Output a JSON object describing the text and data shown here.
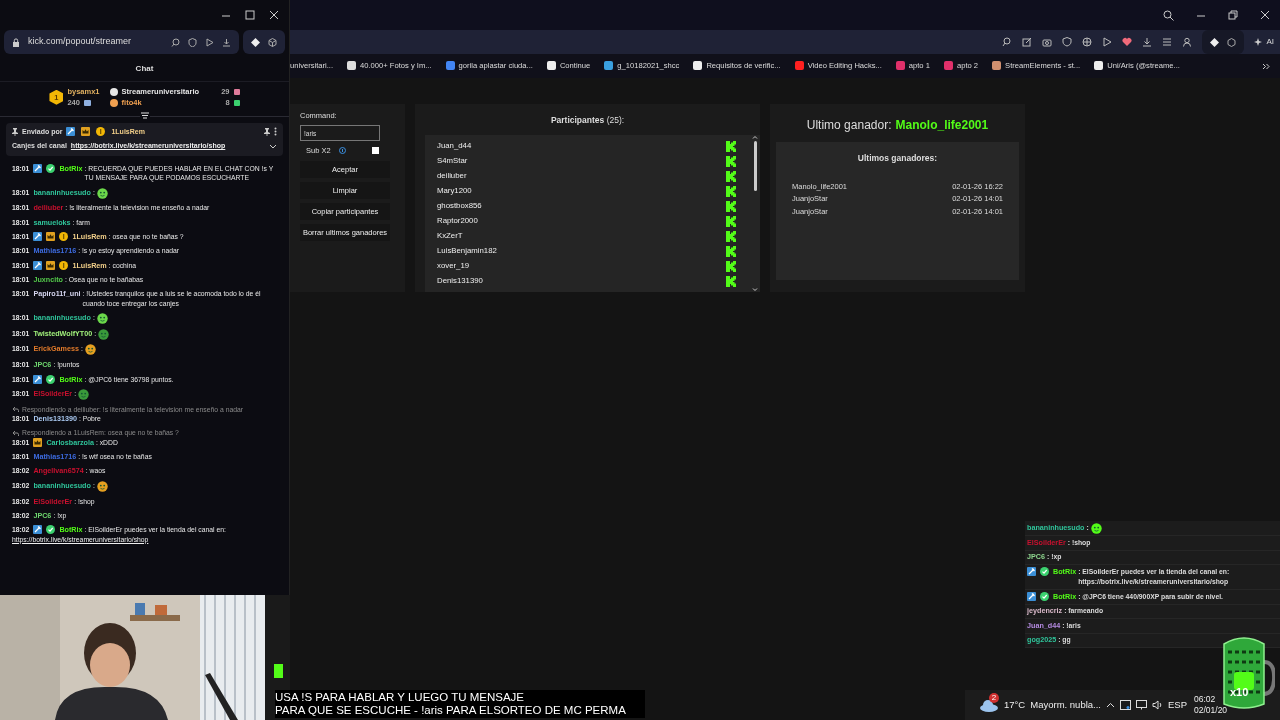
{
  "chat_window": {
    "url": "kick.com/popout/streamer",
    "header": "Chat",
    "top_viewer": {
      "rank": "1",
      "name": "bysamx1",
      "count": "240"
    },
    "leaders": [
      {
        "name": "Streameruniversitario",
        "count": "29",
        "color": "#e6e6e6"
      },
      {
        "name": "fito4k",
        "count": "8",
        "color": "#f0a050"
      }
    ],
    "pinned": {
      "label": "Enviado por",
      "sender": "1LuisRem",
      "text": "Canjes del canal",
      "link": "https://botrix.live/k/streameruniversitario/shop"
    },
    "messages": [
      {
        "time": "18:01",
        "badges": [
          {
            "kind": "hammer"
          },
          {
            "kind": "check"
          }
        ],
        "user": "BotRix",
        "color": "#53fc18",
        "kind": "text",
        "text": ": RECUERDA QUE PUEDES HABLAR EN EL CHAT CON !s Y TU MENSAJE PARA QUE PODAMOS ESCUCHARTE"
      },
      {
        "time": "18:01",
        "user": "bananinhuesudo",
        "color": "#2fc49a",
        "kind": "emote",
        "text": ":"
      },
      {
        "time": "18:01",
        "user": "deiliuber",
        "color": "#c8102e",
        "kind": "text",
        "text": ": !s literalmente la television me enseño a nadar"
      },
      {
        "time": "18:01",
        "user": "samueloks",
        "color": "#2fc49a",
        "kind": "text",
        "text": ": farm"
      },
      {
        "time": "18:01",
        "badges": [
          {
            "kind": "hammer"
          },
          {
            "kind": "crown"
          },
          {
            "kind": "coin"
          }
        ],
        "user": "1LuisRem",
        "color": "#f3d08a",
        "kind": "text",
        "text": ": osea que no te bañas ?"
      },
      {
        "time": "18:01",
        "user": "Mathias1716",
        "color": "#3d6be0",
        "kind": "text",
        "text": ": !s yo estoy aprendiendo a nadar"
      },
      {
        "time": "18:01",
        "badges": [
          {
            "kind": "hammer"
          },
          {
            "kind": "crown"
          },
          {
            "kind": "coin"
          }
        ],
        "user": "1LuisRem",
        "color": "#f3d08a",
        "kind": "text",
        "text": ": cochina"
      },
      {
        "time": "18:01",
        "user": "Juxncito",
        "color": "#53c94a",
        "kind": "text",
        "text": ": Osea que no te bañabas"
      },
      {
        "time": "18:01",
        "user": "Papiro11f_uni",
        "color": "#d6d6f0",
        "kind": "text",
        "text": ": !Ustedes tranquilos que a luis se le acomoda todo lo de él cuando toce entregar los canjes"
      },
      {
        "time": "18:01",
        "user": "bananinhuesudo",
        "color": "#2fc49a",
        "kind": "emote",
        "text": ":"
      },
      {
        "time": "18:01",
        "user": "TwistedWolfYT00",
        "color": "#a0f07a",
        "kind": "emote",
        "text": ":"
      },
      {
        "time": "18:01",
        "user": "ErickGamess",
        "color": "#e07a2a",
        "kind": "emote",
        "text": ":"
      },
      {
        "time": "18:01",
        "user": "JPC6",
        "color": "#6fd66f",
        "kind": "text",
        "text": ": !puntos"
      },
      {
        "time": "18:01",
        "badges": [
          {
            "kind": "hammer"
          },
          {
            "kind": "check"
          }
        ],
        "user": "BotRix",
        "color": "#53fc18",
        "kind": "text",
        "text": ": @JPC6 tiene 36798 puntos."
      },
      {
        "time": "18:01",
        "user": "ElSoilderEr",
        "color": "#c8102e",
        "kind": "emote",
        "text": ":"
      },
      {
        "reply": "Respondiendo a deiliuber: !s literalmente la television me enseño a nadar",
        "time": "18:01",
        "user": "Denis131390",
        "color": "#a9c8f0",
        "kind": "text",
        "text": ": Pobre"
      },
      {
        "reply": "Respondiendo a 1LuisRem: osea que no te bañas ?",
        "time": "18:01",
        "badges": [
          {
            "kind": "crown"
          }
        ],
        "user": "Carlosbarzola",
        "color": "#2fc49a",
        "kind": "text",
        "text": ": xDDD"
      },
      {
        "time": "18:01",
        "user": "Mathias1716",
        "color": "#3d6be0",
        "kind": "text",
        "text": ": !s wtf osea no te bañas"
      },
      {
        "time": "18:02",
        "user": "AngelIvan6574",
        "color": "#c8102e",
        "kind": "text",
        "text": ": waos"
      },
      {
        "time": "18:02",
        "user": "bananinhuesudo",
        "color": "#2fc49a",
        "kind": "emote",
        "text": ":"
      },
      {
        "time": "18:02",
        "user": "ElSoilderEr",
        "color": "#c8102e",
        "kind": "text",
        "text": ": !shop"
      },
      {
        "time": "18:02",
        "user": "JPC6",
        "color": "#6fd66f",
        "kind": "text",
        "text": ": !xp"
      },
      {
        "time": "18:02",
        "badges": [
          {
            "kind": "hammer"
          },
          {
            "kind": "check"
          }
        ],
        "user": "BotRix",
        "color": "#53fc18",
        "kind": "text",
        "text": ": ElSoilderEr puedes ver la tienda del canal en:",
        "link": "https://botrix.live/k/streameruniversitario/shop"
      }
    ]
  },
  "browser": {
    "ai_label": "AI",
    "bookmarks": [
      "universitari...",
      "40.000+ Fotos y Im...",
      "gorila aplastar ciuda...",
      "Continue",
      "g_10182021_shcc",
      "Requisitos de verific...",
      "Video Editing Hacks...",
      "apto 1",
      "apto 2",
      "StreamElements - st...",
      "Uni/Aris (@streame..."
    ]
  },
  "giveaway": {
    "command_label": "Command:",
    "command": "!aris",
    "sub_label": "Sub X2",
    "sub_checked": false,
    "buttons": [
      "Aceptar",
      "Limpiar",
      "Copiar participantes",
      "Borrar ultimos ganadores"
    ],
    "participants_title": "**Participantes** (25):",
    "participants": [
      "Juan_d44",
      "S4mStar",
      "deiliuber",
      "Mary1200",
      "ghostbox856",
      "Raptor2000",
      "KxZerT",
      "LuisBenjamin182",
      "xover_19",
      "Denis131390"
    ],
    "last_winner_label": "Ultimo ganador:",
    "last_winner": "Manolo_life2001",
    "winners_title": "Ultimos ganadores:",
    "winners": [
      {
        "name": "Manolo_life2001",
        "date": "02-01-26 16:22"
      },
      {
        "name": "JuanjoStar",
        "date": "02-01-26 14:01"
      },
      {
        "name": "JuanjoStar",
        "date": "02-01-26 14:01"
      }
    ]
  },
  "overlay_chat": [
    {
      "user": "bananinhuesudo",
      "color": "#2fc49a",
      "kind": "emote",
      "text": ":"
    },
    {
      "user": "ElSoilderEr",
      "color": "#c8102e",
      "kind": "text",
      "text": ": !shop"
    },
    {
      "user": "JPC6",
      "color": "#8fd68f",
      "kind": "text",
      "text": ": !xp"
    },
    {
      "badges": [
        {
          "kind": "hammer"
        },
        {
          "kind": "check"
        }
      ],
      "user": "BotRix",
      "color": "#53fc18",
      "kind": "text",
      "text": ": ElSoilderEr puedes ver la tienda del canal en: https://botrix.live/k/streameruniversitario/shop"
    },
    {
      "badges": [
        {
          "kind": "hammer"
        },
        {
          "kind": "check"
        }
      ],
      "user": "BotRix",
      "color": "#53fc18",
      "kind": "text",
      "text": ": @JPC6 tiene 440/900XP para subir de nivel."
    },
    {
      "user": "jeydencriz",
      "color": "#d8b8c8",
      "kind": "text",
      "text": ": farmeando"
    },
    {
      "user": "Juan_d44",
      "color": "#b48ae0",
      "kind": "text",
      "text": ": !aris"
    },
    {
      "user": "gog2025",
      "color": "#2fc49a",
      "kind": "text",
      "text": ": gg"
    }
  ],
  "caption": [
    "USA !S PARA HABLAR Y LUEGO TU MENSAJE",
    "PARA QUE SE ESCUCHE - !aris PARA ELSORTEO DE MC PERMA"
  ],
  "cup": {
    "label": "x10"
  },
  "taskbar": {
    "weather_alerts": "2",
    "temperature": "17°C",
    "weather": "Mayorm. nubla...",
    "language": "ESP",
    "time": "06:02",
    "date": "02/01/20"
  }
}
